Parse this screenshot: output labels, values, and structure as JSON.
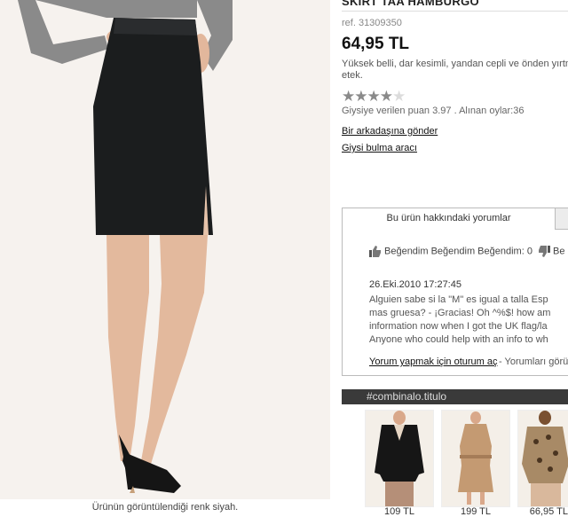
{
  "product": {
    "title": "SKIRT TAA HAMBURGO",
    "ref": "ref. 31309350",
    "price": "64,95 TL",
    "description_line1": "Yüksek belli, dar kesimli, yandan cepli ve önden yırtm",
    "description_line2": "etek.",
    "rating_value": 3.97,
    "rating_max": 5,
    "rating_text": "Giysiye verilen puan 3.97 . Alınan oylar:36",
    "send_friend_link": "Bir arkadaşına gönder",
    "finder_link": "Giysi bulma aracı",
    "image_caption": "Ürünün görüntülendiği renk siyah."
  },
  "comments": {
    "tab_label": "Bu ürün hakkındaki yorumlar",
    "like_text": "Beğendim Beğendim Beğendim: 0",
    "dislike_text": "Be",
    "date": "26.Eki.2010 17:27:45",
    "lines": [
      "Alguien sabe si la \"M\" es igual a talla Esp",
      "mas gruesa? - ¡Gracias! Oh ^%$! how am",
      "information now when I got the UK flag/la",
      "Anyone who could help with an info to wh"
    ],
    "login_link": "Yorum yapmak için oturum aç",
    "others_text": "- Yorumları görü"
  },
  "combinalo": {
    "header": "#combinalo.titulo",
    "items": [
      {
        "price": "109 TL"
      },
      {
        "price": "199 TL"
      },
      {
        "price": "66,95 TL"
      }
    ]
  },
  "colors": {
    "combo_bar": "#3a3a3a",
    "photo_bg": "#f6f2ee",
    "skirt": "#1b1d1e"
  }
}
